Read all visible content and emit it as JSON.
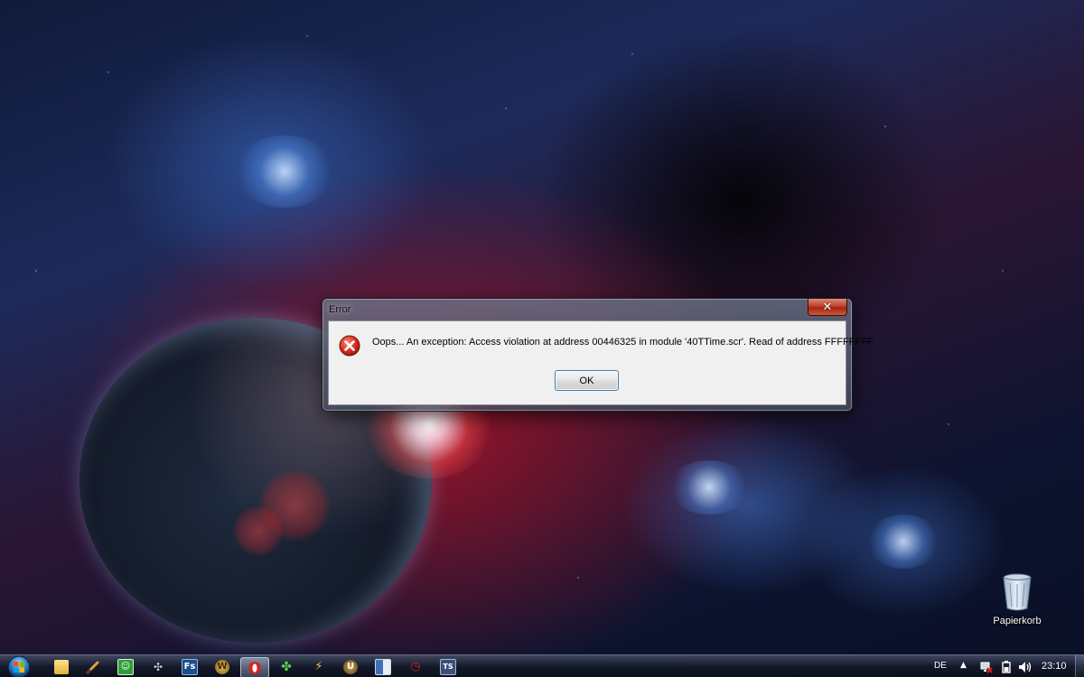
{
  "dialog": {
    "title": "Error",
    "close_icon": "close-x-icon",
    "close_glyph": "✕",
    "icon": "error-icon",
    "message": "Oops... An exception: Access violation at address 00446325 in module '40TTime.scr'. Read of address FFFFFFFF",
    "ok_label": "OK"
  },
  "desktop": {
    "icons": [
      {
        "label": "Papierkorb",
        "icon": "recycle-bin-icon"
      }
    ]
  },
  "taskbar": {
    "start_icon": "windows-start-orb-icon",
    "items": [
      {
        "icon": "folder-icon",
        "active": false
      },
      {
        "icon": "brush-icon",
        "active": false
      },
      {
        "icon": "green-app-icon",
        "active": false
      },
      {
        "icon": "bug-icon",
        "active": false
      },
      {
        "icon": "fs-app-icon",
        "label": "Fs",
        "active": false
      },
      {
        "icon": "warcraft-icon",
        "label": "W",
        "active": false
      },
      {
        "icon": "opera-icon",
        "active": true
      },
      {
        "icon": "clover-icon",
        "active": false
      },
      {
        "icon": "bolt-app-icon",
        "active": false
      },
      {
        "icon": "unreal-icon",
        "label": "U",
        "active": false
      },
      {
        "icon": "document-app-icon",
        "active": false
      },
      {
        "icon": "red-clock-app-icon",
        "active": false
      },
      {
        "icon": "teamspeak-icon",
        "label": "TS",
        "active": false
      }
    ],
    "tray": {
      "language": "DE",
      "arrow": "▲",
      "icons": [
        "network-icon",
        "power-icon",
        "volume-icon"
      ],
      "clock": "23:10"
    }
  },
  "colors": {
    "dialog_bg": "#f0f0f0",
    "close_button": "#c0432c",
    "ok_border": "#3c7fb1",
    "error_red": "#d92e22"
  }
}
